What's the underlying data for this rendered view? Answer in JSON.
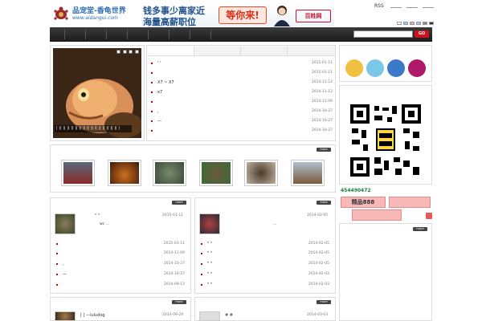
{
  "header": {
    "logo_cn": "品宠堂-香龟世界",
    "logo_url": "www.aidangui.com",
    "rss": "RSS"
  },
  "banner": {
    "line1": "钱多事少离家近",
    "line2": "海量高薪职位",
    "cta": "等你来!",
    "brand": "百姓网"
  },
  "search": {
    "placeholder": "",
    "button": "GO"
  },
  "more_label": "more",
  "feature": {
    "caption": "[ ][ ][ ][ ][ ][ ][ ][ ][ ][ ][ ][ ][ ][ ][ ][ ]"
  },
  "news": {
    "items": [
      {
        "title": "' '",
        "date": "2015-01-11"
      },
      {
        "title": "",
        "date": "2015-01-11"
      },
      {
        "title": "X7 ~ X7",
        "date": "2014-11-12"
      },
      {
        "title": "x7",
        "date": "2014-11-12"
      },
      {
        "title": "",
        "date": "2014-11-09"
      },
      {
        "title": ",",
        "date": "2014-10-27"
      },
      {
        "title": "—",
        "date": "2014-10-27"
      },
      {
        "title": "",
        "date": "2014-10-27"
      }
    ]
  },
  "card1": {
    "featured_title": "\"  \"",
    "featured_desc": "wc          ...",
    "featured_date": "2015-01-11",
    "items": [
      {
        "title": "",
        "date": "2015-01-11"
      },
      {
        "title": "",
        "date": "2014-11-09"
      },
      {
        "title": ",",
        "date": "2014-10-27"
      },
      {
        "title": "—",
        "date": "2014-10-27"
      },
      {
        "title": "",
        "date": "2014-09-13"
      }
    ]
  },
  "card2": {
    "featured_title": "",
    "featured_desc": "...",
    "featured_date": "2014-02-05",
    "items": [
      {
        "title": "\"   \"",
        "date": "2014-02-05"
      },
      {
        "title": "\"   \"",
        "date": "2014-02-05"
      },
      {
        "title": "\"   \"",
        "date": "2014-02-05"
      },
      {
        "title": "\"   \"",
        "date": "2014-02-03"
      },
      {
        "title": "\"   \"",
        "date": "2014-02-03"
      }
    ]
  },
  "card3": {
    "title": "[      ]      —luludog",
    "date": "2014-09-29"
  },
  "card4": {
    "title": "#          #",
    "date": "2014-03-03"
  },
  "sidebar": {
    "qq": "454490472",
    "btn1": "精品888",
    "btn2": "",
    "btn3": ""
  },
  "colors": {
    "accent_red": "#d0111b",
    "nav_bg": "#232323",
    "pink": "#f8b8b8"
  }
}
